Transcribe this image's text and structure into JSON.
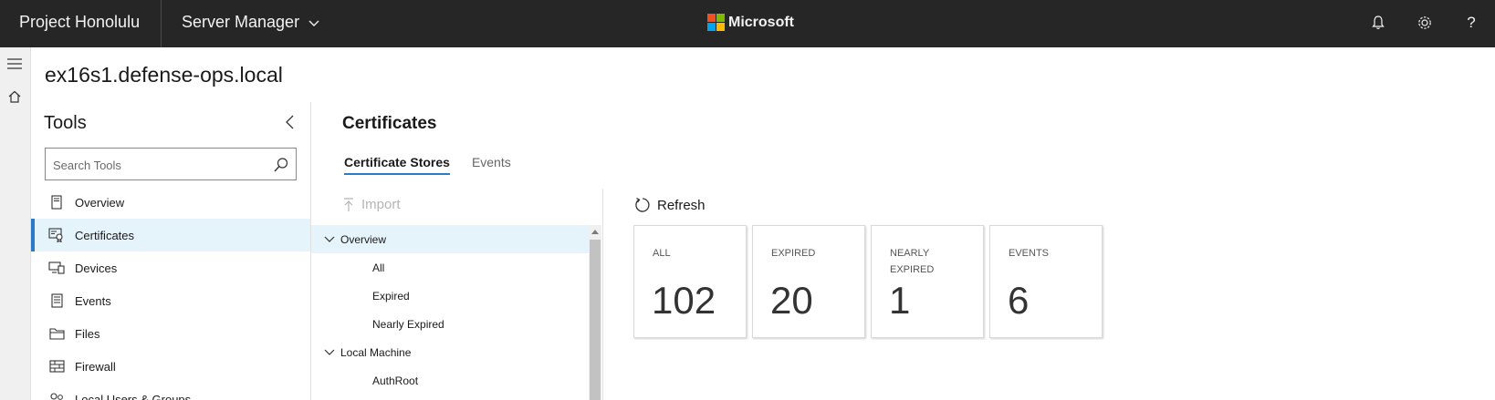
{
  "topbar": {
    "app_title": "Project Honolulu",
    "server_manager": "Server Manager",
    "brand": "Microsoft",
    "icons": [
      "bell-icon",
      "gear-icon",
      "help-icon"
    ]
  },
  "page": {
    "title": "ex16s1.defense-ops.local"
  },
  "tools": {
    "header": "Tools",
    "search_placeholder": "Search Tools",
    "items": [
      {
        "label": "Overview",
        "icon": "server-icon",
        "active": false
      },
      {
        "label": "Certificates",
        "icon": "certificate-icon",
        "active": true
      },
      {
        "label": "Devices",
        "icon": "devices-icon",
        "active": false
      },
      {
        "label": "Events",
        "icon": "events-icon",
        "active": false
      },
      {
        "label": "Files",
        "icon": "folder-icon",
        "active": false
      },
      {
        "label": "Firewall",
        "icon": "firewall-icon",
        "active": false
      },
      {
        "label": "Local Users & Groups",
        "icon": "users-icon",
        "active": false
      }
    ]
  },
  "certificates": {
    "title": "Certificates",
    "tabs": [
      {
        "label": "Certificate Stores",
        "active": true
      },
      {
        "label": "Events",
        "active": false
      }
    ],
    "import_label": "Import",
    "refresh_label": "Refresh",
    "tree": [
      {
        "label": "Overview",
        "level": 0,
        "expanded": true,
        "selected": true
      },
      {
        "label": "All",
        "level": 1
      },
      {
        "label": "Expired",
        "level": 1
      },
      {
        "label": "Nearly Expired",
        "level": 1
      },
      {
        "label": "Local Machine",
        "level": 0,
        "expanded": true
      },
      {
        "label": "AuthRoot",
        "level": 1
      }
    ],
    "tiles": [
      {
        "label": "ALL",
        "value": "102"
      },
      {
        "label": "EXPIRED",
        "value": "20"
      },
      {
        "label": "NEARLY EXPIRED",
        "value": "1"
      },
      {
        "label": "EVENTS",
        "value": "6"
      }
    ]
  },
  "colors": {
    "topbar_bg": "#262626",
    "accent": "#2a7cc4",
    "selected_bg": "#e5f3fb"
  }
}
